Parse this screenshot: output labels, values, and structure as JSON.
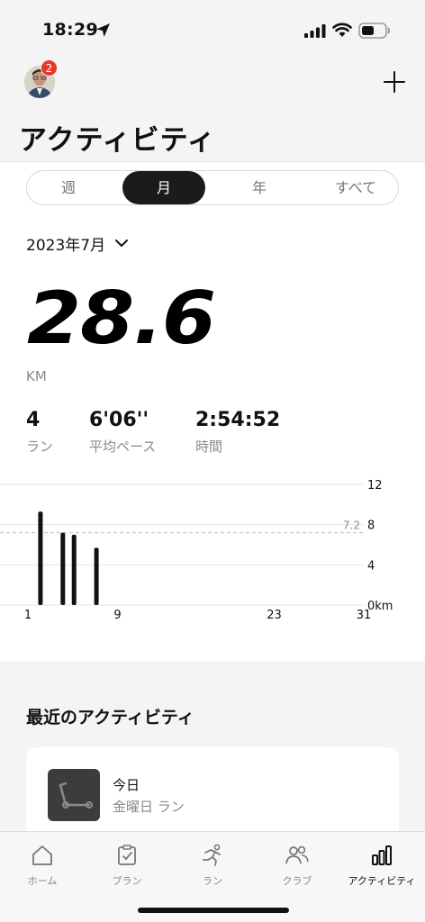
{
  "status_bar": {
    "time": "18:29"
  },
  "header": {
    "title": "アクティビティ",
    "avatar_badge": "2"
  },
  "segments": [
    "週",
    "月",
    "年",
    "すべて"
  ],
  "segment_active": 1,
  "date_select": {
    "label": "2023年7月"
  },
  "summary": {
    "distance": "28.6",
    "unit": "KM",
    "stats": [
      {
        "value": "4",
        "label": "ラン"
      },
      {
        "value": "6'06''",
        "label": "平均ペース"
      },
      {
        "value": "2:54:52",
        "label": "時間"
      }
    ]
  },
  "chart_data": {
    "type": "bar",
    "x": [
      2,
      4,
      5,
      7
    ],
    "values": [
      9.3,
      7.2,
      7.0,
      5.7
    ],
    "xticks": [
      "1",
      "9",
      "23",
      "31"
    ],
    "yticks": [
      "12",
      "8",
      "4",
      "0km"
    ],
    "ylim": [
      0,
      12
    ],
    "average": 7.2,
    "average_label": "7.2",
    "grid": true
  },
  "recent": {
    "title": "最近のアクティビティ",
    "item": {
      "title": "今日",
      "subtitle": "金曜日 ラン"
    }
  },
  "tabs": [
    {
      "label": "ホーム",
      "icon": "home-icon"
    },
    {
      "label": "プラン",
      "icon": "plan-icon"
    },
    {
      "label": "ラン",
      "icon": "run-icon"
    },
    {
      "label": "クラブ",
      "icon": "club-icon"
    },
    {
      "label": "アクティビティ",
      "icon": "activity-icon"
    }
  ],
  "active_tab": 4
}
